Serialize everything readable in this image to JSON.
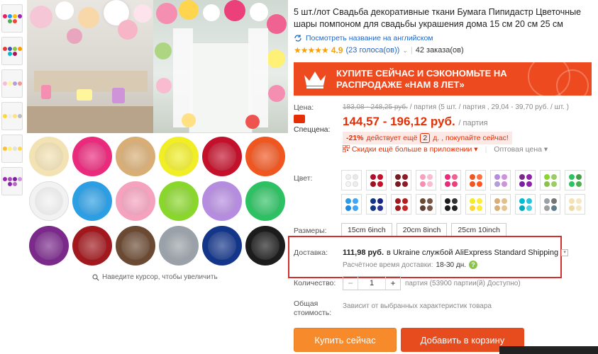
{
  "title": "5 шт./лот Свадьба декоративные ткани Бумага Пипидастр Цветочные шары помпоном для свадьбы украшения дома 15 см 20 см 25 см",
  "translate_link": "Посмотреть название на английском",
  "rating": {
    "stars": "★★★★★",
    "score": "4.9",
    "votes": "(23 голоса(ов))",
    "orders": "42 заказа(ов)"
  },
  "banner": {
    "text": "КУПИТЕ СЕЙЧАС И СЭКОНОМЬТЕ НА РАСПРОДАЖЕ «НАМ 8 ЛЕТ»"
  },
  "price": {
    "label": "Цена:",
    "old": "183,08 - 248,25 руб.",
    "old_unit": "/ партия",
    "old_piece": "(5 шт. / партия , 29,04 - 39,70 руб. / шт. )",
    "sale_label": "Спеццена:",
    "new": "144,57 - 196,12 руб.",
    "new_unit": "/ партия",
    "discount_pct": "-21%",
    "discount_text": "действует ещё",
    "discount_days": "2",
    "discount_tail": "д. , покупайте сейчас!",
    "app_discount": "Скидки ещё больше в приложении",
    "wholesale": "Оптовая цена"
  },
  "options": {
    "color_label": "Цвет:",
    "size_label": "Размеры:",
    "sizes": [
      "15cm 6inch",
      "20cm 8inch",
      "25cm 10inch"
    ]
  },
  "shipping": {
    "label": "Доставка:",
    "price": "111,98 руб.",
    "middle": "в Ukraine службой AliExpress Standard Shipping",
    "eta_label": "Расчётное время доставки:",
    "eta": "18-30 дн."
  },
  "quantity": {
    "label": "Количество:",
    "value": "1",
    "minus": "−",
    "plus": "+",
    "info": "партия (53900 партии(й) Доступно)"
  },
  "total": {
    "label": "Общая стоимость:",
    "text": "Зависит от выбранных характеристик товара"
  },
  "buttons": {
    "buy": "Купить сейчас",
    "cart": "Добавить в корзину"
  },
  "zoom_hint": "Наведите курсор, чтобы увеличить",
  "colors": {
    "accent": "#e62e04",
    "banner": "#ee4a1f",
    "buy": "#f78a2b",
    "cart": "#e74c1f",
    "highlight": "#d32f2f"
  }
}
